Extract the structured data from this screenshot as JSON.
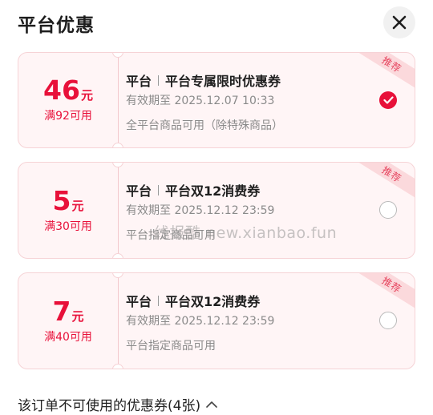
{
  "header": {
    "title": "平台优惠"
  },
  "coupons": [
    {
      "amount": "46",
      "unit": "元",
      "condition": "满92可用",
      "tag": "平台",
      "name": "平台专属限时优惠券",
      "expiry": "有效期至 2025.12.07 10:33",
      "scope": "全平台商品可用（除特殊商品）",
      "badge": "推荐",
      "selected": true
    },
    {
      "amount": "5",
      "unit": "元",
      "condition": "满30可用",
      "tag": "平台",
      "name": "平台双12消费券",
      "expiry": "有效期至 2025.12.12 23:59",
      "scope": "平台指定商品可用",
      "badge": "推荐",
      "selected": false
    },
    {
      "amount": "7",
      "unit": "元",
      "condition": "满40可用",
      "tag": "平台",
      "name": "平台双12消费券",
      "expiry": "有效期至 2025.12.12 23:59",
      "scope": "平台指定商品可用",
      "badge": "推荐",
      "selected": false
    }
  ],
  "watermark": "线报酷 new.xianbao.fun",
  "footer": {
    "unavailable_label": "该订单不可使用的优惠券(4张)"
  },
  "colors": {
    "accent": "#e8113a",
    "coupon_bg": "#fff5f6",
    "badge_bg": "#fbd9dc"
  },
  "icons": {
    "close": "close-icon",
    "check": "check-icon",
    "chevron": "chevron-up-icon"
  }
}
